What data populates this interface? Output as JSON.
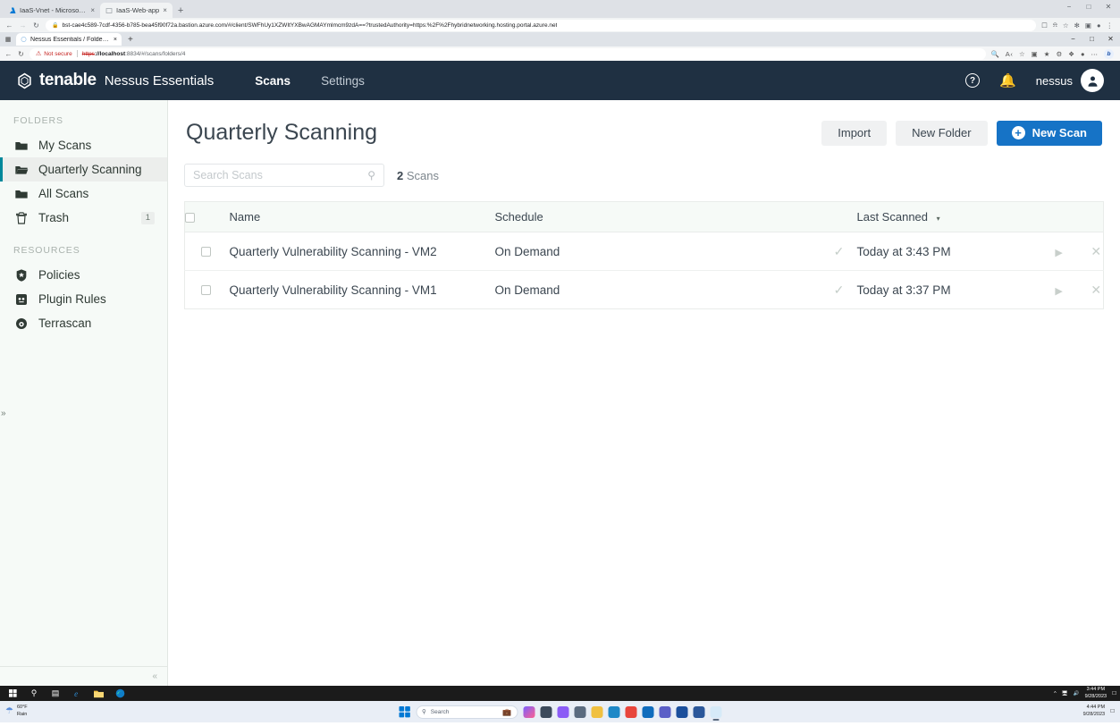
{
  "outer_browser": {
    "tabs": [
      {
        "title": "IaaS-Vnet - Microsoft Azure",
        "active": false,
        "favicon": "azure-icon"
      },
      {
        "title": "IaaS-Web-app",
        "active": true,
        "favicon": "page-icon"
      }
    ],
    "new_tab_label": "+",
    "close_label": "×",
    "url": "bst-cae4c589-7cdf-4356-b785-bea45f90f72a.bastion.azure.com/#/client/SWFhUy1XZWItYXBwAGMAYmlmcm9zdA==?trustedAuthority=https:%2F%2Fhybridnetworking.hosting.portal.azure.net",
    "lock_icon": "lock-icon",
    "nav": {
      "back": "←",
      "forward": "→",
      "reload": "↻"
    },
    "toolbar_icons": [
      "cast-icon",
      "share-icon",
      "bookmark-star-icon",
      "extensions-puzzle-icon",
      "sidepanel-icon",
      "profile-icon",
      "menu-kebab-icon"
    ],
    "window_controls": {
      "minimize": "−",
      "maximize": "□",
      "close": "✕"
    }
  },
  "inner_browser": {
    "system_icon": "tab-actions-icon",
    "tabs": [
      {
        "title": "Nessus Essentials / Folders / Cu",
        "active": true,
        "favicon": "loading-spinner-icon"
      }
    ],
    "new_tab_label": "+",
    "close_label": "×",
    "security_label": "Not secure",
    "warn_icon": "warning-triangle-icon",
    "url_protocol": "https",
    "url_host": "://localhost",
    "url_path": ":8834/#/scans/folders/4",
    "nav": {
      "back": "←",
      "reload": "↻"
    },
    "toolbar_icons": [
      "zoom-icon",
      "read-aloud-icon",
      "favorites-star-icon",
      "split-screen-icon",
      "collections-icon",
      "browser-essentials-icon",
      "extensions-icon",
      "profile-icon",
      "settings-kebab-icon"
    ],
    "copilot_label": "b",
    "window_controls": {
      "minimize": "−",
      "maximize": "□",
      "close": "✕"
    }
  },
  "app": {
    "brand_name": "tenable",
    "product_name": "Nessus Essentials",
    "nav": [
      {
        "label": "Scans",
        "active": true
      },
      {
        "label": "Settings",
        "active": false
      }
    ],
    "help_label": "?",
    "bell_icon": "notification-bell-icon",
    "username": "nessus",
    "avatar_icon": "user-avatar-icon"
  },
  "sidebar": {
    "folders_title": "FOLDERS",
    "folders": [
      {
        "label": "My Scans",
        "icon": "folder-icon",
        "active": false,
        "badge": ""
      },
      {
        "label": "Quarterly Scanning",
        "icon": "folder-open-icon",
        "active": true,
        "badge": ""
      },
      {
        "label": "All Scans",
        "icon": "folder-icon",
        "active": false,
        "badge": ""
      },
      {
        "label": "Trash",
        "icon": "trash-icon",
        "active": false,
        "badge": "1"
      }
    ],
    "resources_title": "RESOURCES",
    "resources": [
      {
        "label": "Policies",
        "icon": "shield-icon"
      },
      {
        "label": "Plugin Rules",
        "icon": "plugin-icon"
      },
      {
        "label": "Terrascan",
        "icon": "terrascan-icon"
      }
    ],
    "collapse_label": "«",
    "bastion_expand_label": "»"
  },
  "main": {
    "page_title": "Quarterly Scanning",
    "buttons": {
      "import": "Import",
      "new_folder": "New Folder",
      "new_scan": "New Scan",
      "new_scan_icon": "plus-circle-icon"
    },
    "search": {
      "placeholder": "Search Scans",
      "value": "",
      "icon": "search-icon"
    },
    "scan_count_number": "2",
    "scan_count_label": "Scans",
    "table": {
      "headers": {
        "select_all": "select-all-checkbox",
        "name": "Name",
        "schedule": "Schedule",
        "last_scanned": "Last Scanned",
        "sort_caret": "▾"
      },
      "rows": [
        {
          "name": "Quarterly Vulnerability Scanning - VM2",
          "schedule": "On Demand",
          "status_icon": "check-icon",
          "last_scanned": "Today at 3:43 PM",
          "launch_icon": "play-icon",
          "stop_icon": "close-x-icon"
        },
        {
          "name": "Quarterly Vulnerability Scanning - VM1",
          "schedule": "On Demand",
          "status_icon": "check-icon",
          "last_scanned": "Today at 3:37 PM",
          "launch_icon": "play-icon",
          "stop_icon": "close-x-icon"
        }
      ]
    }
  },
  "vm_taskbar": {
    "icons": [
      "windows-start-icon",
      "search-icon",
      "task-view-icon",
      "internet-explorer-icon",
      "file-explorer-icon",
      "edge-icon"
    ],
    "tray_icons": [
      "chevron-up-icon",
      "network-icon",
      "volume-muted-icon"
    ],
    "time": "3:44 PM",
    "date": "9/28/2023",
    "show-desktop": "notification-center-icon"
  },
  "host_taskbar": {
    "weather_temp": "60°F",
    "weather_cond": "Rain",
    "weather_icon": "rain-cloud-icon",
    "start_icon": "windows-11-start-icon",
    "search_placeholder": "Search",
    "search_icon": "search-icon",
    "apps": [
      "copilot-icon",
      "widgets-icon",
      "file-explorer-icon",
      "messenger-icon",
      "settings-icon",
      "folder-icon",
      "edge-icon",
      "chrome-icon",
      "outlook-icon",
      "teams-icon",
      "store-icon",
      "word-icon",
      "azure-bastion-icon"
    ],
    "time": "4:44 PM",
    "date": "9/28/2023"
  },
  "colors": {
    "nav_bar": "#1f3042",
    "primary_button": "#1673c6",
    "active_accent": "#00889b",
    "page_bg": "#f6faf7",
    "not_secure": "#c5221f"
  }
}
